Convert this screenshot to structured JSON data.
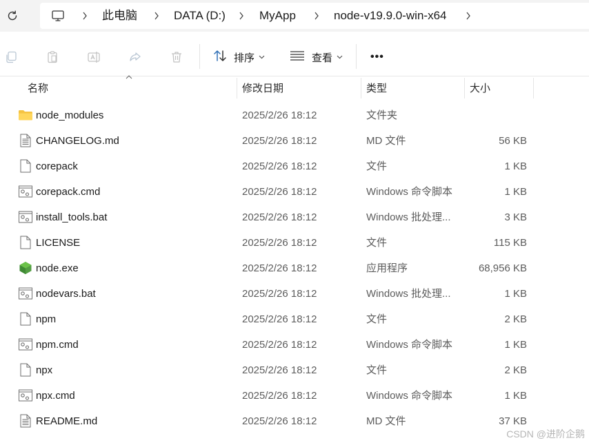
{
  "breadcrumb": {
    "items": [
      "此电脑",
      "DATA (D:)",
      "MyApp",
      "node-v19.9.0-win-x64"
    ]
  },
  "toolbar": {
    "sort_label": "排序",
    "view_label": "查看",
    "more_label": "•••"
  },
  "columns": {
    "name": "名称",
    "date": "修改日期",
    "type": "类型",
    "size": "大小"
  },
  "files": [
    {
      "name": "node_modules",
      "date": "2025/2/26 18:12",
      "type": "文件夹",
      "size": "",
      "icon": "folder-icon"
    },
    {
      "name": "CHANGELOG.md",
      "date": "2025/2/26 18:12",
      "type": "MD 文件",
      "size": "56 KB",
      "icon": "text-file-icon"
    },
    {
      "name": "corepack",
      "date": "2025/2/26 18:12",
      "type": "文件",
      "size": "1 KB",
      "icon": "file-icon"
    },
    {
      "name": "corepack.cmd",
      "date": "2025/2/26 18:12",
      "type": "Windows 命令脚本",
      "size": "1 KB",
      "icon": "script-file-icon"
    },
    {
      "name": "install_tools.bat",
      "date": "2025/2/26 18:12",
      "type": "Windows 批处理...",
      "size": "3 KB",
      "icon": "script-file-icon"
    },
    {
      "name": "LICENSE",
      "date": "2025/2/26 18:12",
      "type": "文件",
      "size": "115 KB",
      "icon": "file-icon"
    },
    {
      "name": "node.exe",
      "date": "2025/2/26 18:12",
      "type": "应用程序",
      "size": "68,956 KB",
      "icon": "node-exe-icon"
    },
    {
      "name": "nodevars.bat",
      "date": "2025/2/26 18:12",
      "type": "Windows 批处理...",
      "size": "1 KB",
      "icon": "script-file-icon"
    },
    {
      "name": "npm",
      "date": "2025/2/26 18:12",
      "type": "文件",
      "size": "2 KB",
      "icon": "file-icon"
    },
    {
      "name": "npm.cmd",
      "date": "2025/2/26 18:12",
      "type": "Windows 命令脚本",
      "size": "1 KB",
      "icon": "script-file-icon"
    },
    {
      "name": "npx",
      "date": "2025/2/26 18:12",
      "type": "文件",
      "size": "2 KB",
      "icon": "file-icon"
    },
    {
      "name": "npx.cmd",
      "date": "2025/2/26 18:12",
      "type": "Windows 命令脚本",
      "size": "1 KB",
      "icon": "script-file-icon"
    },
    {
      "name": "README.md",
      "date": "2025/2/26 18:12",
      "type": "MD 文件",
      "size": "37 KB",
      "icon": "text-file-icon"
    }
  ],
  "watermark": "CSDN @进阶企鹅"
}
